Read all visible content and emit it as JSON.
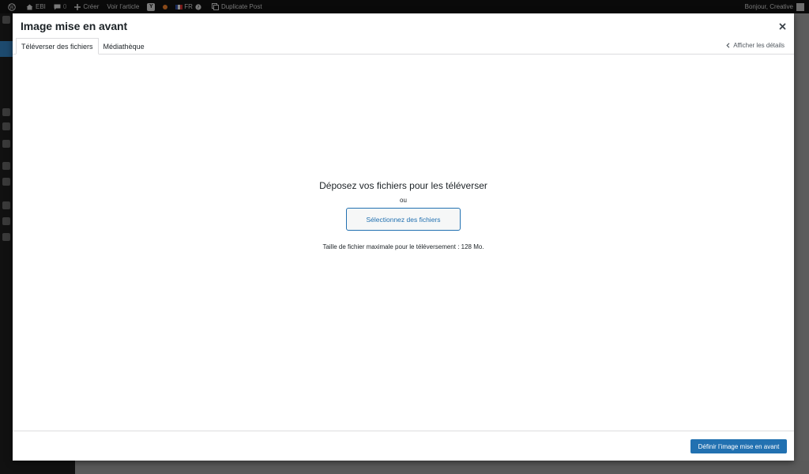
{
  "adminbar": {
    "site_name": "EBI",
    "comments_count": "0",
    "create_label": "Créer",
    "view_post_label": "Voir l’article",
    "language": "FR",
    "duplicate_label": "Duplicate Post",
    "greeting": "Bonjour, Creative"
  },
  "modal": {
    "title": "Image mise en avant",
    "tabs": [
      {
        "label": "Téléverser des fichiers",
        "active": true
      },
      {
        "label": "Médiathèque",
        "active": false
      }
    ],
    "details_link": "Afficher les détails",
    "upload": {
      "drop_title": "Déposez vos fichiers pour les téléverser",
      "or_label": "ou",
      "select_button": "Sélectionnez des fichiers",
      "max_size": "Taille de fichier maximale pour le téléversement : 128 Mo."
    },
    "primary_button": "Définir l’image mise en avant"
  },
  "colors": {
    "accent": "#2271b1",
    "adminbar_bg": "#1d2327",
    "text": "#1d2327"
  }
}
